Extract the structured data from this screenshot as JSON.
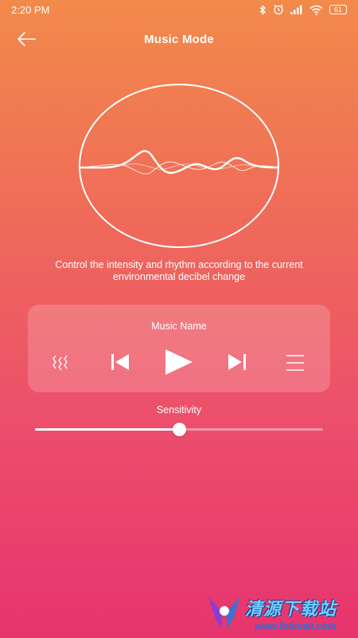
{
  "status_bar": {
    "time": "2:20 PM",
    "battery": "61"
  },
  "header": {
    "title": "Music Mode"
  },
  "description": {
    "line1": "Control the intensity and rhythm according to the current",
    "line2": "environmental decibel change"
  },
  "player": {
    "music_name": "Music Name"
  },
  "sensitivity": {
    "label": "Sensitivity",
    "value_percent": 50
  },
  "watermark": {
    "text": "清源下载站",
    "url": "www.fotimeit.com"
  },
  "colors": {
    "gradient_top": "#f28a4a",
    "gradient_bottom": "#e7346f",
    "foreground": "#ffffff"
  }
}
